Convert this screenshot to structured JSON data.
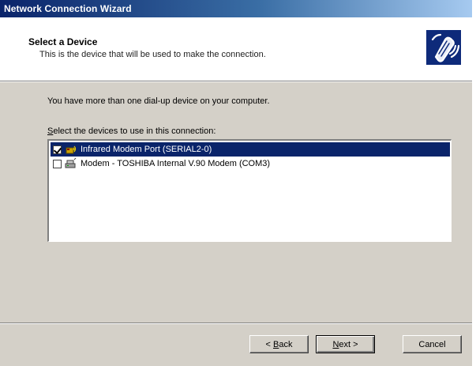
{
  "window": {
    "title": "Network Connection Wizard"
  },
  "header": {
    "title": "Select a Device",
    "subtitle": "This is the device that will be used to make the connection.",
    "icon": "modem-phone-icon"
  },
  "body": {
    "intro": "You have more than one dial-up device on your computer.",
    "list_label_accel": "S",
    "list_label_rest": "elect the devices to use in this connection:",
    "devices": [
      {
        "label": "Infrared Modem Port (SERIAL2-0)",
        "checked": true,
        "selected": true,
        "icon": "infrared-port-icon"
      },
      {
        "label": "Modem - TOSHIBA Internal V.90 Modem (COM3)",
        "checked": false,
        "selected": false,
        "icon": "modem-icon"
      }
    ]
  },
  "buttons": {
    "back_prefix": "< ",
    "back_accel": "B",
    "back_rest": "ack",
    "next_accel": "N",
    "next_rest": "ext >",
    "cancel": "Cancel"
  },
  "colors": {
    "selection": "#0a246a",
    "title_gradient_start": "#0a246a",
    "title_gradient_end": "#a6caf0",
    "dialog_face": "#d4d0c8"
  }
}
